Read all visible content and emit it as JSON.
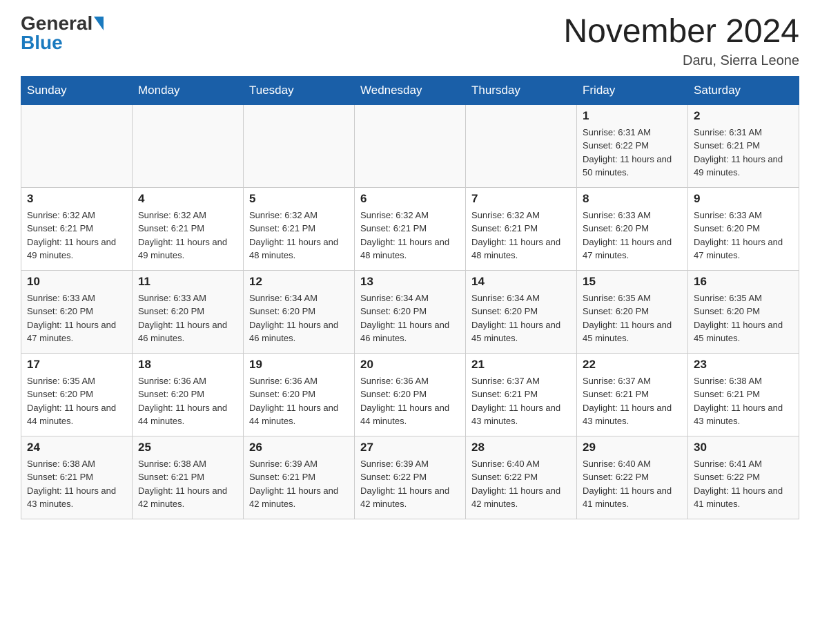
{
  "header": {
    "logo_general": "General",
    "logo_blue": "Blue",
    "month_title": "November 2024",
    "location": "Daru, Sierra Leone"
  },
  "weekdays": [
    "Sunday",
    "Monday",
    "Tuesday",
    "Wednesday",
    "Thursday",
    "Friday",
    "Saturday"
  ],
  "weeks": [
    [
      {
        "day": "",
        "info": ""
      },
      {
        "day": "",
        "info": ""
      },
      {
        "day": "",
        "info": ""
      },
      {
        "day": "",
        "info": ""
      },
      {
        "day": "",
        "info": ""
      },
      {
        "day": "1",
        "info": "Sunrise: 6:31 AM\nSunset: 6:22 PM\nDaylight: 11 hours and 50 minutes."
      },
      {
        "day": "2",
        "info": "Sunrise: 6:31 AM\nSunset: 6:21 PM\nDaylight: 11 hours and 49 minutes."
      }
    ],
    [
      {
        "day": "3",
        "info": "Sunrise: 6:32 AM\nSunset: 6:21 PM\nDaylight: 11 hours and 49 minutes."
      },
      {
        "day": "4",
        "info": "Sunrise: 6:32 AM\nSunset: 6:21 PM\nDaylight: 11 hours and 49 minutes."
      },
      {
        "day": "5",
        "info": "Sunrise: 6:32 AM\nSunset: 6:21 PM\nDaylight: 11 hours and 48 minutes."
      },
      {
        "day": "6",
        "info": "Sunrise: 6:32 AM\nSunset: 6:21 PM\nDaylight: 11 hours and 48 minutes."
      },
      {
        "day": "7",
        "info": "Sunrise: 6:32 AM\nSunset: 6:21 PM\nDaylight: 11 hours and 48 minutes."
      },
      {
        "day": "8",
        "info": "Sunrise: 6:33 AM\nSunset: 6:20 PM\nDaylight: 11 hours and 47 minutes."
      },
      {
        "day": "9",
        "info": "Sunrise: 6:33 AM\nSunset: 6:20 PM\nDaylight: 11 hours and 47 minutes."
      }
    ],
    [
      {
        "day": "10",
        "info": "Sunrise: 6:33 AM\nSunset: 6:20 PM\nDaylight: 11 hours and 47 minutes."
      },
      {
        "day": "11",
        "info": "Sunrise: 6:33 AM\nSunset: 6:20 PM\nDaylight: 11 hours and 46 minutes."
      },
      {
        "day": "12",
        "info": "Sunrise: 6:34 AM\nSunset: 6:20 PM\nDaylight: 11 hours and 46 minutes."
      },
      {
        "day": "13",
        "info": "Sunrise: 6:34 AM\nSunset: 6:20 PM\nDaylight: 11 hours and 46 minutes."
      },
      {
        "day": "14",
        "info": "Sunrise: 6:34 AM\nSunset: 6:20 PM\nDaylight: 11 hours and 45 minutes."
      },
      {
        "day": "15",
        "info": "Sunrise: 6:35 AM\nSunset: 6:20 PM\nDaylight: 11 hours and 45 minutes."
      },
      {
        "day": "16",
        "info": "Sunrise: 6:35 AM\nSunset: 6:20 PM\nDaylight: 11 hours and 45 minutes."
      }
    ],
    [
      {
        "day": "17",
        "info": "Sunrise: 6:35 AM\nSunset: 6:20 PM\nDaylight: 11 hours and 44 minutes."
      },
      {
        "day": "18",
        "info": "Sunrise: 6:36 AM\nSunset: 6:20 PM\nDaylight: 11 hours and 44 minutes."
      },
      {
        "day": "19",
        "info": "Sunrise: 6:36 AM\nSunset: 6:20 PM\nDaylight: 11 hours and 44 minutes."
      },
      {
        "day": "20",
        "info": "Sunrise: 6:36 AM\nSunset: 6:20 PM\nDaylight: 11 hours and 44 minutes."
      },
      {
        "day": "21",
        "info": "Sunrise: 6:37 AM\nSunset: 6:21 PM\nDaylight: 11 hours and 43 minutes."
      },
      {
        "day": "22",
        "info": "Sunrise: 6:37 AM\nSunset: 6:21 PM\nDaylight: 11 hours and 43 minutes."
      },
      {
        "day": "23",
        "info": "Sunrise: 6:38 AM\nSunset: 6:21 PM\nDaylight: 11 hours and 43 minutes."
      }
    ],
    [
      {
        "day": "24",
        "info": "Sunrise: 6:38 AM\nSunset: 6:21 PM\nDaylight: 11 hours and 43 minutes."
      },
      {
        "day": "25",
        "info": "Sunrise: 6:38 AM\nSunset: 6:21 PM\nDaylight: 11 hours and 42 minutes."
      },
      {
        "day": "26",
        "info": "Sunrise: 6:39 AM\nSunset: 6:21 PM\nDaylight: 11 hours and 42 minutes."
      },
      {
        "day": "27",
        "info": "Sunrise: 6:39 AM\nSunset: 6:22 PM\nDaylight: 11 hours and 42 minutes."
      },
      {
        "day": "28",
        "info": "Sunrise: 6:40 AM\nSunset: 6:22 PM\nDaylight: 11 hours and 42 minutes."
      },
      {
        "day": "29",
        "info": "Sunrise: 6:40 AM\nSunset: 6:22 PM\nDaylight: 11 hours and 41 minutes."
      },
      {
        "day": "30",
        "info": "Sunrise: 6:41 AM\nSunset: 6:22 PM\nDaylight: 11 hours and 41 minutes."
      }
    ]
  ]
}
